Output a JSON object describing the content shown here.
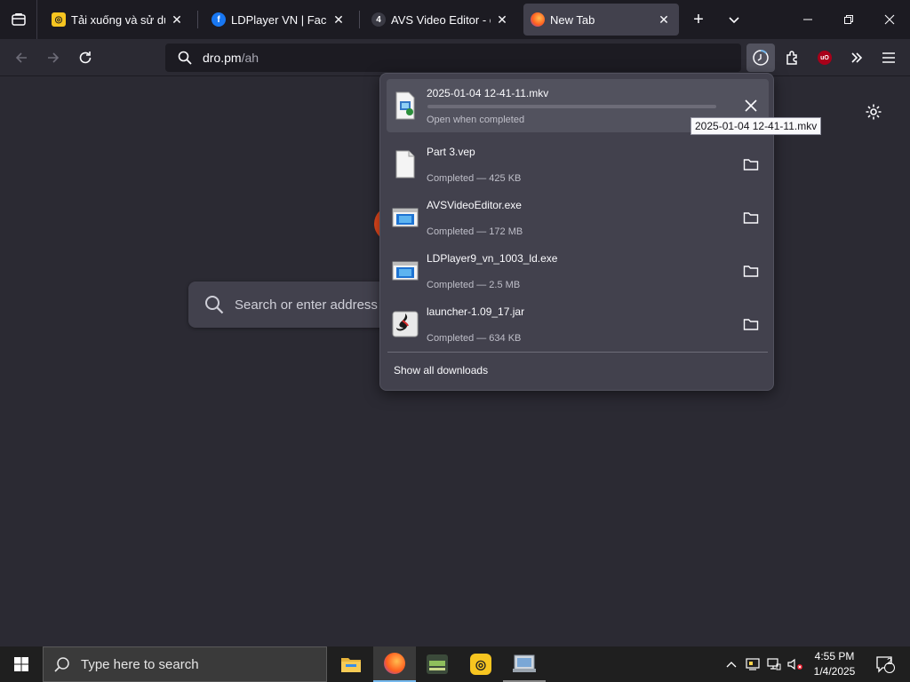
{
  "browser": {
    "tabs": [
      {
        "title": "Tải xuống và sử dụng LDPlayer",
        "icon": "ldplayer-icon",
        "active": false
      },
      {
        "title": "LDPlayer VN | Facebook",
        "icon": "facebook-icon",
        "active": false
      },
      {
        "title": "AVS Video Editor - easy",
        "icon": "avs-icon",
        "active": false
      },
      {
        "title": "New Tab",
        "icon": "firefox-icon",
        "active": true
      }
    ],
    "url": {
      "host": "dro.pm",
      "path": "/ah"
    }
  },
  "newtab": {
    "search_placeholder": "Search or enter address"
  },
  "downloads": {
    "items": [
      {
        "name": "2025-01-04 12-41-11.mkv",
        "status": "Open when completed",
        "progress": 0.0,
        "in_progress": true,
        "icon": "video-file-icon"
      },
      {
        "name": "Part 3.vep",
        "status": "Completed — 425 KB",
        "icon": "blank-file-icon"
      },
      {
        "name": "AVSVideoEditor.exe",
        "status": "Completed — 172 MB",
        "icon": "exe-file-icon"
      },
      {
        "name": "LDPlayer9_vn_1003_ld.exe",
        "status": "Completed — 2.5 MB",
        "icon": "exe-file-icon"
      },
      {
        "name": "launcher-1.09_17.jar",
        "status": "Completed — 634 KB",
        "icon": "java-file-icon"
      }
    ],
    "show_all": "Show all downloads",
    "tooltip": "2025-01-04 12-41-11.mkv"
  },
  "taskbar": {
    "search_placeholder": "Type here to search",
    "time": "4:55 PM",
    "date": "1/4/2025",
    "notifications": "2"
  },
  "colors": {
    "accent": "#76b9ed",
    "panel": "#42414d",
    "chrome": "#1c1b22"
  }
}
